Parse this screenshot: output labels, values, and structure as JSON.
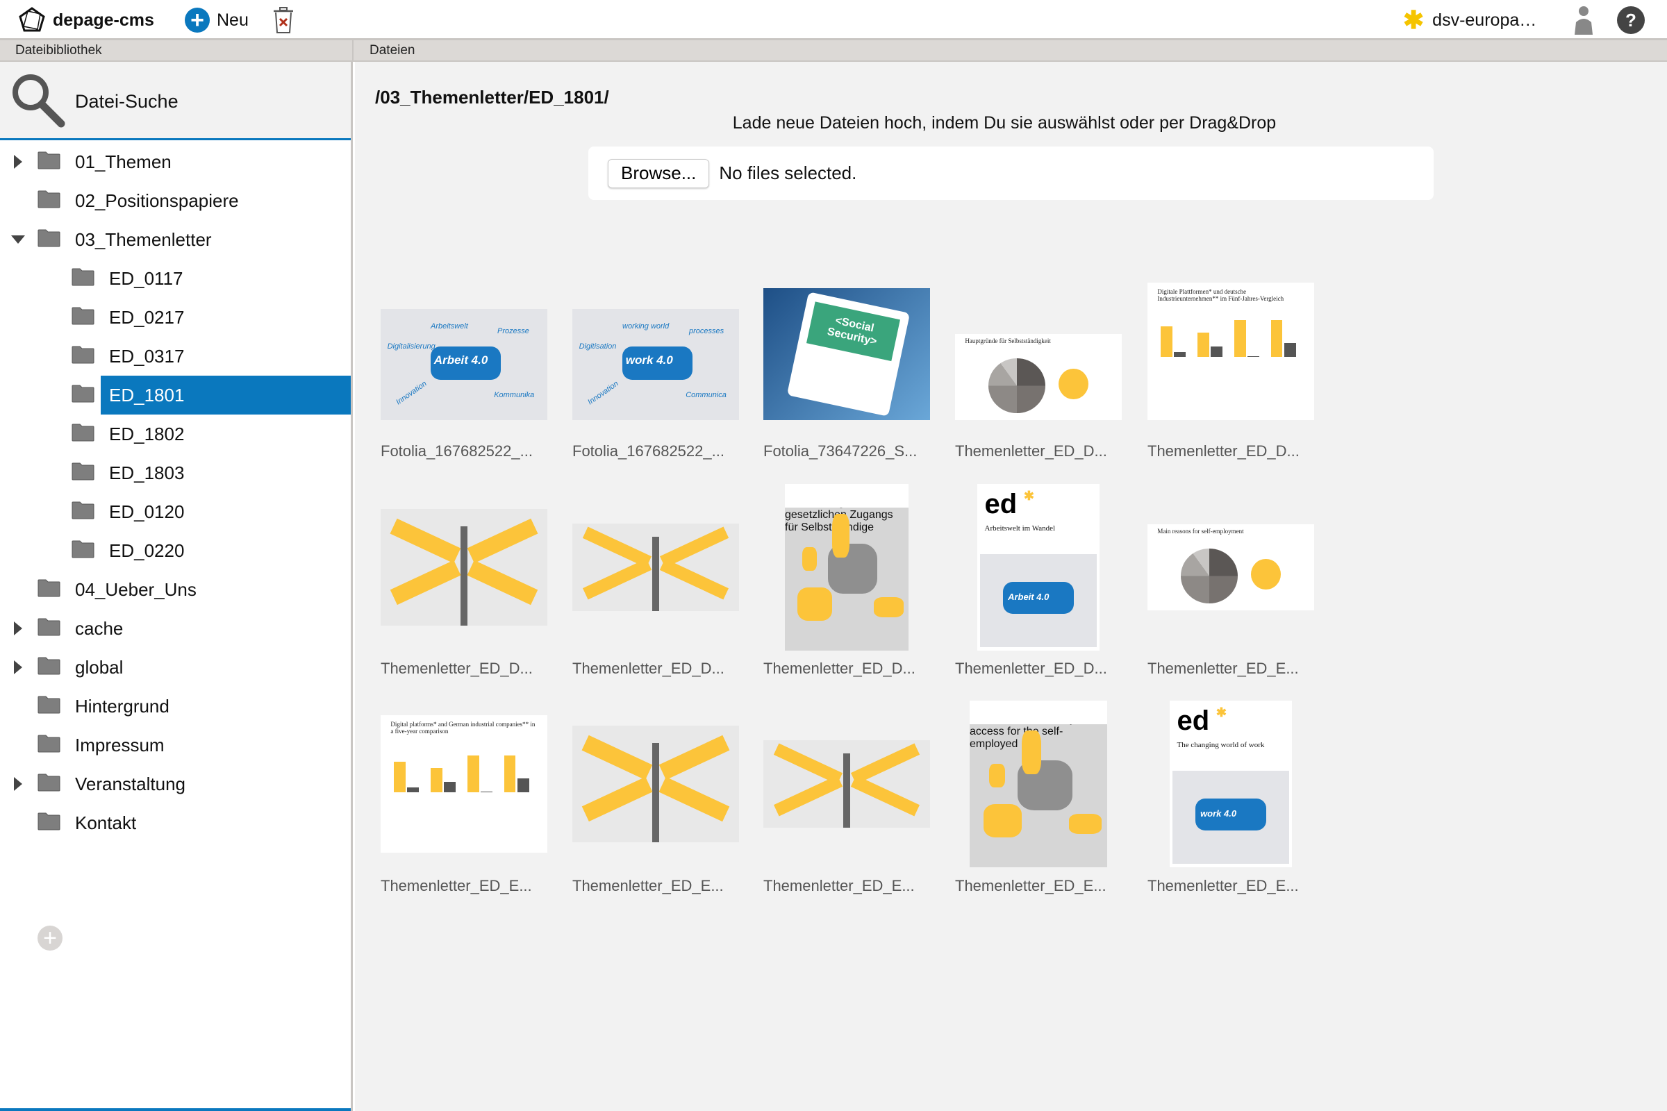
{
  "topbar": {
    "app_name": "depage-cms",
    "new_label": "Neu",
    "project_name": "dsv-europa…",
    "help_label": "?"
  },
  "panels": {
    "left_title": "Dateibibliothek",
    "right_title": "Dateien"
  },
  "sidebar": {
    "search_label": "Datei-Suche",
    "tree": [
      {
        "label": "01_Themen",
        "level": 0,
        "toggle": "closed",
        "selected": false
      },
      {
        "label": "02_Positionspapiere",
        "level": 0,
        "toggle": "none",
        "selected": false
      },
      {
        "label": "03_Themenletter",
        "level": 0,
        "toggle": "open",
        "selected": false
      },
      {
        "label": "ED_0117",
        "level": 1,
        "toggle": "none",
        "selected": false
      },
      {
        "label": "ED_0217",
        "level": 1,
        "toggle": "none",
        "selected": false
      },
      {
        "label": "ED_0317",
        "level": 1,
        "toggle": "none",
        "selected": false
      },
      {
        "label": "ED_1801",
        "level": 1,
        "toggle": "none",
        "selected": true
      },
      {
        "label": "ED_1802",
        "level": 1,
        "toggle": "none",
        "selected": false
      },
      {
        "label": "ED_1803",
        "level": 1,
        "toggle": "none",
        "selected": false
      },
      {
        "label": "ED_0120",
        "level": 1,
        "toggle": "none",
        "selected": false
      },
      {
        "label": "ED_0220",
        "level": 1,
        "toggle": "none",
        "selected": false
      },
      {
        "label": "04_Ueber_Uns",
        "level": 0,
        "toggle": "none",
        "selected": false
      },
      {
        "label": "cache",
        "level": 0,
        "toggle": "closed",
        "selected": false
      },
      {
        "label": "global",
        "level": 0,
        "toggle": "closed",
        "selected": false
      },
      {
        "label": "Hintergrund",
        "level": 0,
        "toggle": "none",
        "selected": false
      },
      {
        "label": "Impressum",
        "level": 0,
        "toggle": "none",
        "selected": false
      },
      {
        "label": "Veranstaltung",
        "level": 0,
        "toggle": "closed",
        "selected": false
      },
      {
        "label": "Kontakt",
        "level": 0,
        "toggle": "none",
        "selected": false
      }
    ],
    "add_label": "+"
  },
  "main": {
    "path": "/03_Themenletter/ED_1801/",
    "upload_hint": "Lade neue Dateien hoch, indem Du sie auswählst oder per Drag&Drop",
    "browse_label": "Browse...",
    "no_files_label": "No files selected.",
    "files": [
      {
        "name": "Fotolia_167682522_...",
        "thumb": "puzzle-arbeit",
        "thumb_text": "Arbeit 4.0"
      },
      {
        "name": "Fotolia_167682522_...",
        "thumb": "puzzle-work",
        "thumb_text": "work 4.0"
      },
      {
        "name": "Fotolia_73647226_S...",
        "thumb": "tablet",
        "thumb_text": "<Social Security>"
      },
      {
        "name": "Themenletter_ED_D...",
        "thumb": "pie-de",
        "thumb_text": "Hauptgründe für Selbstständigkeit"
      },
      {
        "name": "Themenletter_ED_D...",
        "thumb": "bars-de",
        "thumb_text": "Digitale Plattformen* und deutsche Industrieunternehmen** im Fünf-Jahres-Vergleich"
      },
      {
        "name": "Themenletter_ED_D...",
        "thumb": "sign-de-large",
        "thumb_text": ""
      },
      {
        "name": "Themenletter_ED_D...",
        "thumb": "sign-de-small",
        "thumb_text": ""
      },
      {
        "name": "Themenletter_ED_D...",
        "thumb": "map-de",
        "thumb_text": "Jüngste Reformen zur Erweiterung des gesetzlichen Zugangs für Selbstständige"
      },
      {
        "name": "Themenletter_ED_D...",
        "thumb": "cover-de",
        "thumb_text": "Arbeitswelt im Wandel"
      },
      {
        "name": "Themenletter_ED_E...",
        "thumb": "pie-en",
        "thumb_text": "Main reasons for self-employment"
      },
      {
        "name": "Themenletter_ED_E...",
        "thumb": "bars-en",
        "thumb_text": "Digital platforms* and German industrial companies** in a five-year comparison"
      },
      {
        "name": "Themenletter_ED_E...",
        "thumb": "sign-en-large",
        "thumb_text": ""
      },
      {
        "name": "Themenletter_ED_E...",
        "thumb": "sign-en-small",
        "thumb_text": ""
      },
      {
        "name": "Themenletter_ED_E...",
        "thumb": "map-en",
        "thumb_text": "Recent reforms on extension of statutory access for the self-employed"
      },
      {
        "name": "Themenletter_ED_E...",
        "thumb": "cover-en",
        "thumb_text": "The changing world of work"
      }
    ]
  },
  "colors": {
    "accent": "#0a78be",
    "highlight_yellow": "#fcc43a"
  }
}
